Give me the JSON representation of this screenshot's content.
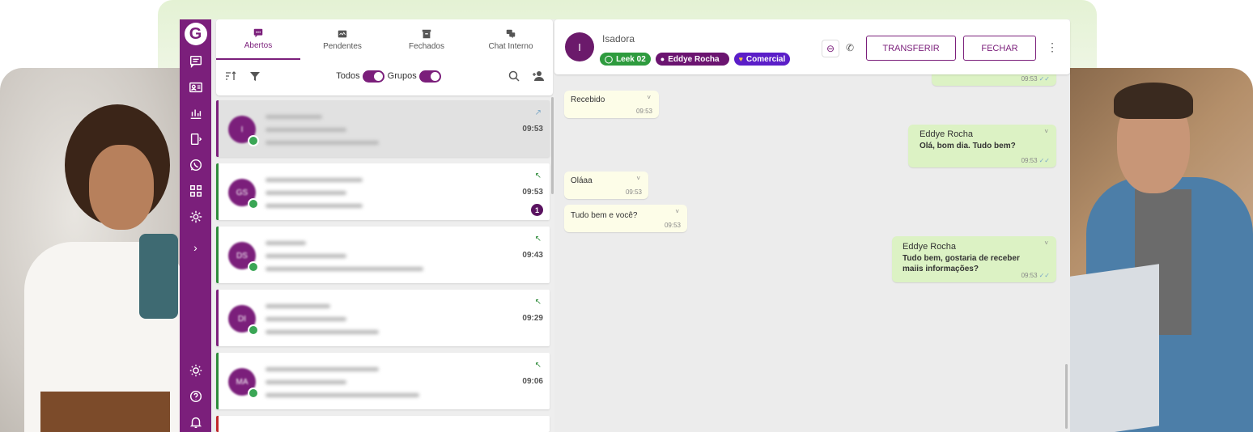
{
  "tabs": [
    {
      "label": "Abertos",
      "icon": "chat-bubble-icon",
      "active": true
    },
    {
      "label": "Pendentes",
      "icon": "inbox-icon",
      "active": false
    },
    {
      "label": "Fechados",
      "icon": "archive-box-icon",
      "active": false
    },
    {
      "label": "Chat Interno",
      "icon": "internal-chat-icon",
      "active": false
    }
  ],
  "filters": {
    "todos_label": "Todos",
    "grupos_label": "Grupos"
  },
  "conversations": [
    {
      "initials": "I",
      "time": "09:53",
      "selected": true,
      "border": "#7b1f7b",
      "arrow": "↗",
      "unread": ""
    },
    {
      "initials": "GS",
      "time": "09:53",
      "selected": false,
      "border": "#2e8b3a",
      "arrow": "↖",
      "unread": "1"
    },
    {
      "initials": "DS",
      "time": "09:43",
      "selected": false,
      "border": "#2e8b3a",
      "arrow": "↖",
      "unread": ""
    },
    {
      "initials": "DI",
      "time": "09:29",
      "selected": false,
      "border": "#7b1f7b",
      "arrow": "↖",
      "unread": ""
    },
    {
      "initials": "MA",
      "time": "09:06",
      "selected": false,
      "border": "#2e8b3a",
      "arrow": "↖",
      "unread": ""
    }
  ],
  "chat": {
    "avatar_initial": "I",
    "contact_name": "Isadora",
    "chips": {
      "connection": "Leek 02",
      "agent": "Eddye Rocha",
      "queue": "Comercial"
    },
    "transfer_label": "TRANSFERIR",
    "close_label": "FECHAR"
  },
  "messages": [
    {
      "type": "out",
      "time": "09:53"
    },
    {
      "type": "in",
      "text": "Recebido",
      "time": "09:53"
    },
    {
      "type": "out",
      "sender": "Eddye Rocha",
      "text": "Olá, bom dia. Tudo bem?",
      "time": "09:53"
    },
    {
      "type": "in",
      "text": "Oláaa",
      "time": "09:53"
    },
    {
      "type": "in",
      "text": "Tudo bem e você?",
      "time": "09:53"
    },
    {
      "type": "out",
      "sender": "Eddye Rocha",
      "text": "Tudo bem, gostaria de receber maiis informações?",
      "time": "09:53"
    }
  ],
  "colors": {
    "brand": "#7b1f7b",
    "outgoing_bubble": "#dcf2c4",
    "incoming_bubble": "#fdfde8"
  }
}
